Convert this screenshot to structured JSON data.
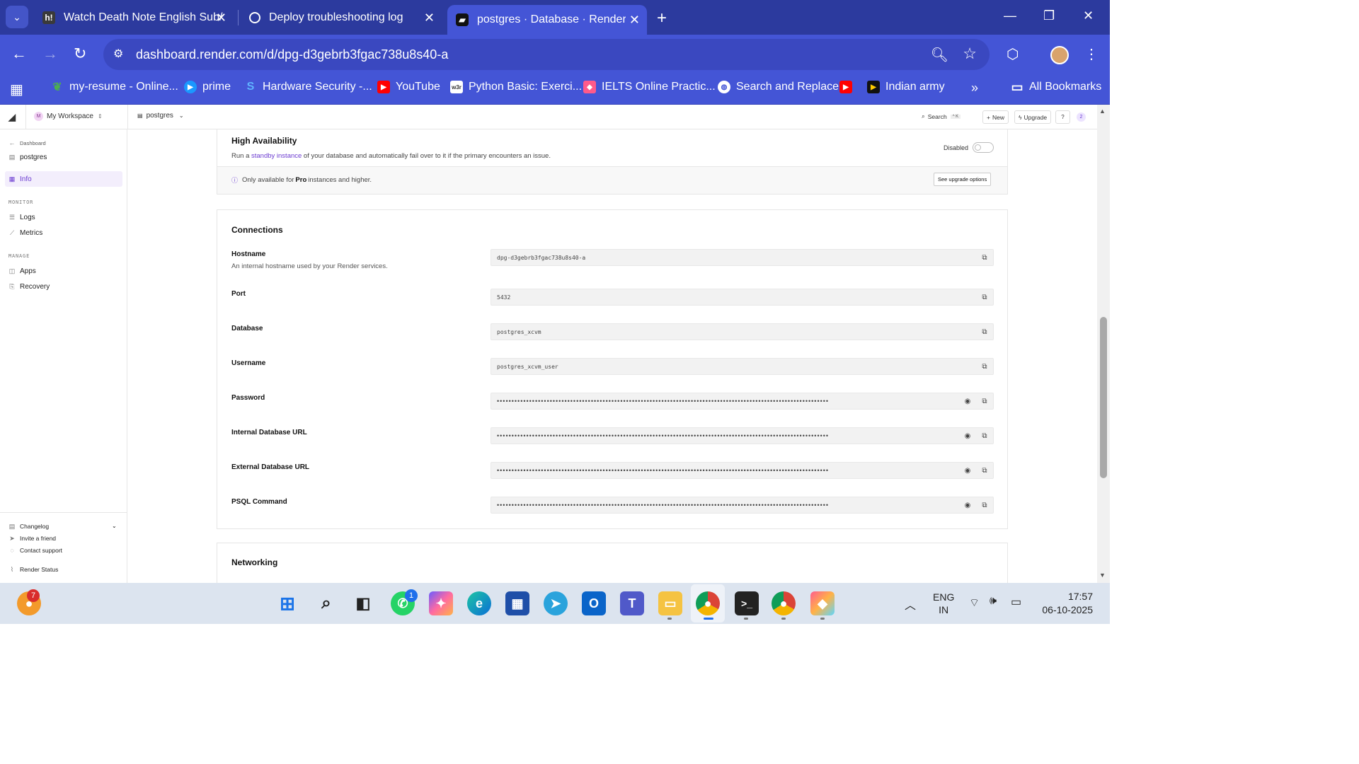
{
  "browser": {
    "tabs": [
      {
        "title": "Watch Death Note English Sub/",
        "favicon": "h!",
        "active": false
      },
      {
        "title": "Deploy troubleshooting log",
        "favicon": "chatgpt-icon",
        "active": false
      },
      {
        "title": "postgres · Database · Render D",
        "favicon": "render-icon",
        "active": true
      }
    ],
    "url": "dashboard.render.com/d/dpg-d3gebrb3fgac738u8s40-a",
    "bookmarks": [
      "my-resume - Online...",
      "prime",
      "Hardware Security -...",
      "YouTube",
      "Python Basic: Exerci...",
      "IELTS Online Practic...",
      "Search and Replace",
      "",
      "Indian army"
    ],
    "all_bookmarks": "All Bookmarks",
    "overflow": "»"
  },
  "topbar": {
    "workspace_initial": "M",
    "workspace": "My Workspace",
    "service": "postgres",
    "search": "Search",
    "search_shortcut": "^ K",
    "new": "New",
    "upgrade": "Upgrade",
    "help": "?",
    "notifications": "2"
  },
  "sidebar": {
    "back": "Dashboard",
    "service": "postgres",
    "info": "Info",
    "monitor_head": "MONITOR",
    "logs": "Logs",
    "metrics": "Metrics",
    "manage_head": "MANAGE",
    "apps": "Apps",
    "recovery": "Recovery",
    "changelog": "Changelog",
    "invite": "Invite a friend",
    "contact": "Contact support",
    "status": "Render Status"
  },
  "ha": {
    "title": "High Availability",
    "desc_pre": "Run a ",
    "desc_link": "standby instance",
    "desc_post": " of your database and automatically fail over to it if the primary encounters an issue.",
    "status": "Disabled",
    "note_pre": "Only available for ",
    "note_bold": "Pro",
    "note_post": " instances and higher.",
    "upgrade_button": "See upgrade options"
  },
  "connections": {
    "title": "Connections",
    "hostname_label": "Hostname",
    "hostname_desc": "An internal hostname used by your Render services.",
    "hostname_value": "dpg-d3gebrb3fgac738u8s40-a",
    "port_label": "Port",
    "port_value": "5432",
    "database_label": "Database",
    "database_value": "postgres_xcvm",
    "username_label": "Username",
    "username_value": "postgres_xcvm_user",
    "password_label": "Password",
    "internal_url_label": "Internal Database URL",
    "external_url_label": "External Database URL",
    "psql_label": "PSQL Command",
    "masked": "•••••••••••••••••••••••••••••••••••••••••••••••••••••••••••••••••••••••••••••••••••••••••••••••••••••••••••••••••"
  },
  "networking": {
    "title": "Networking"
  },
  "taskbar": {
    "notif_badge": "7",
    "whatsapp_badge": "1",
    "lang": "ENG",
    "region": "IN",
    "time": "17:57",
    "date": "06-10-2025"
  }
}
